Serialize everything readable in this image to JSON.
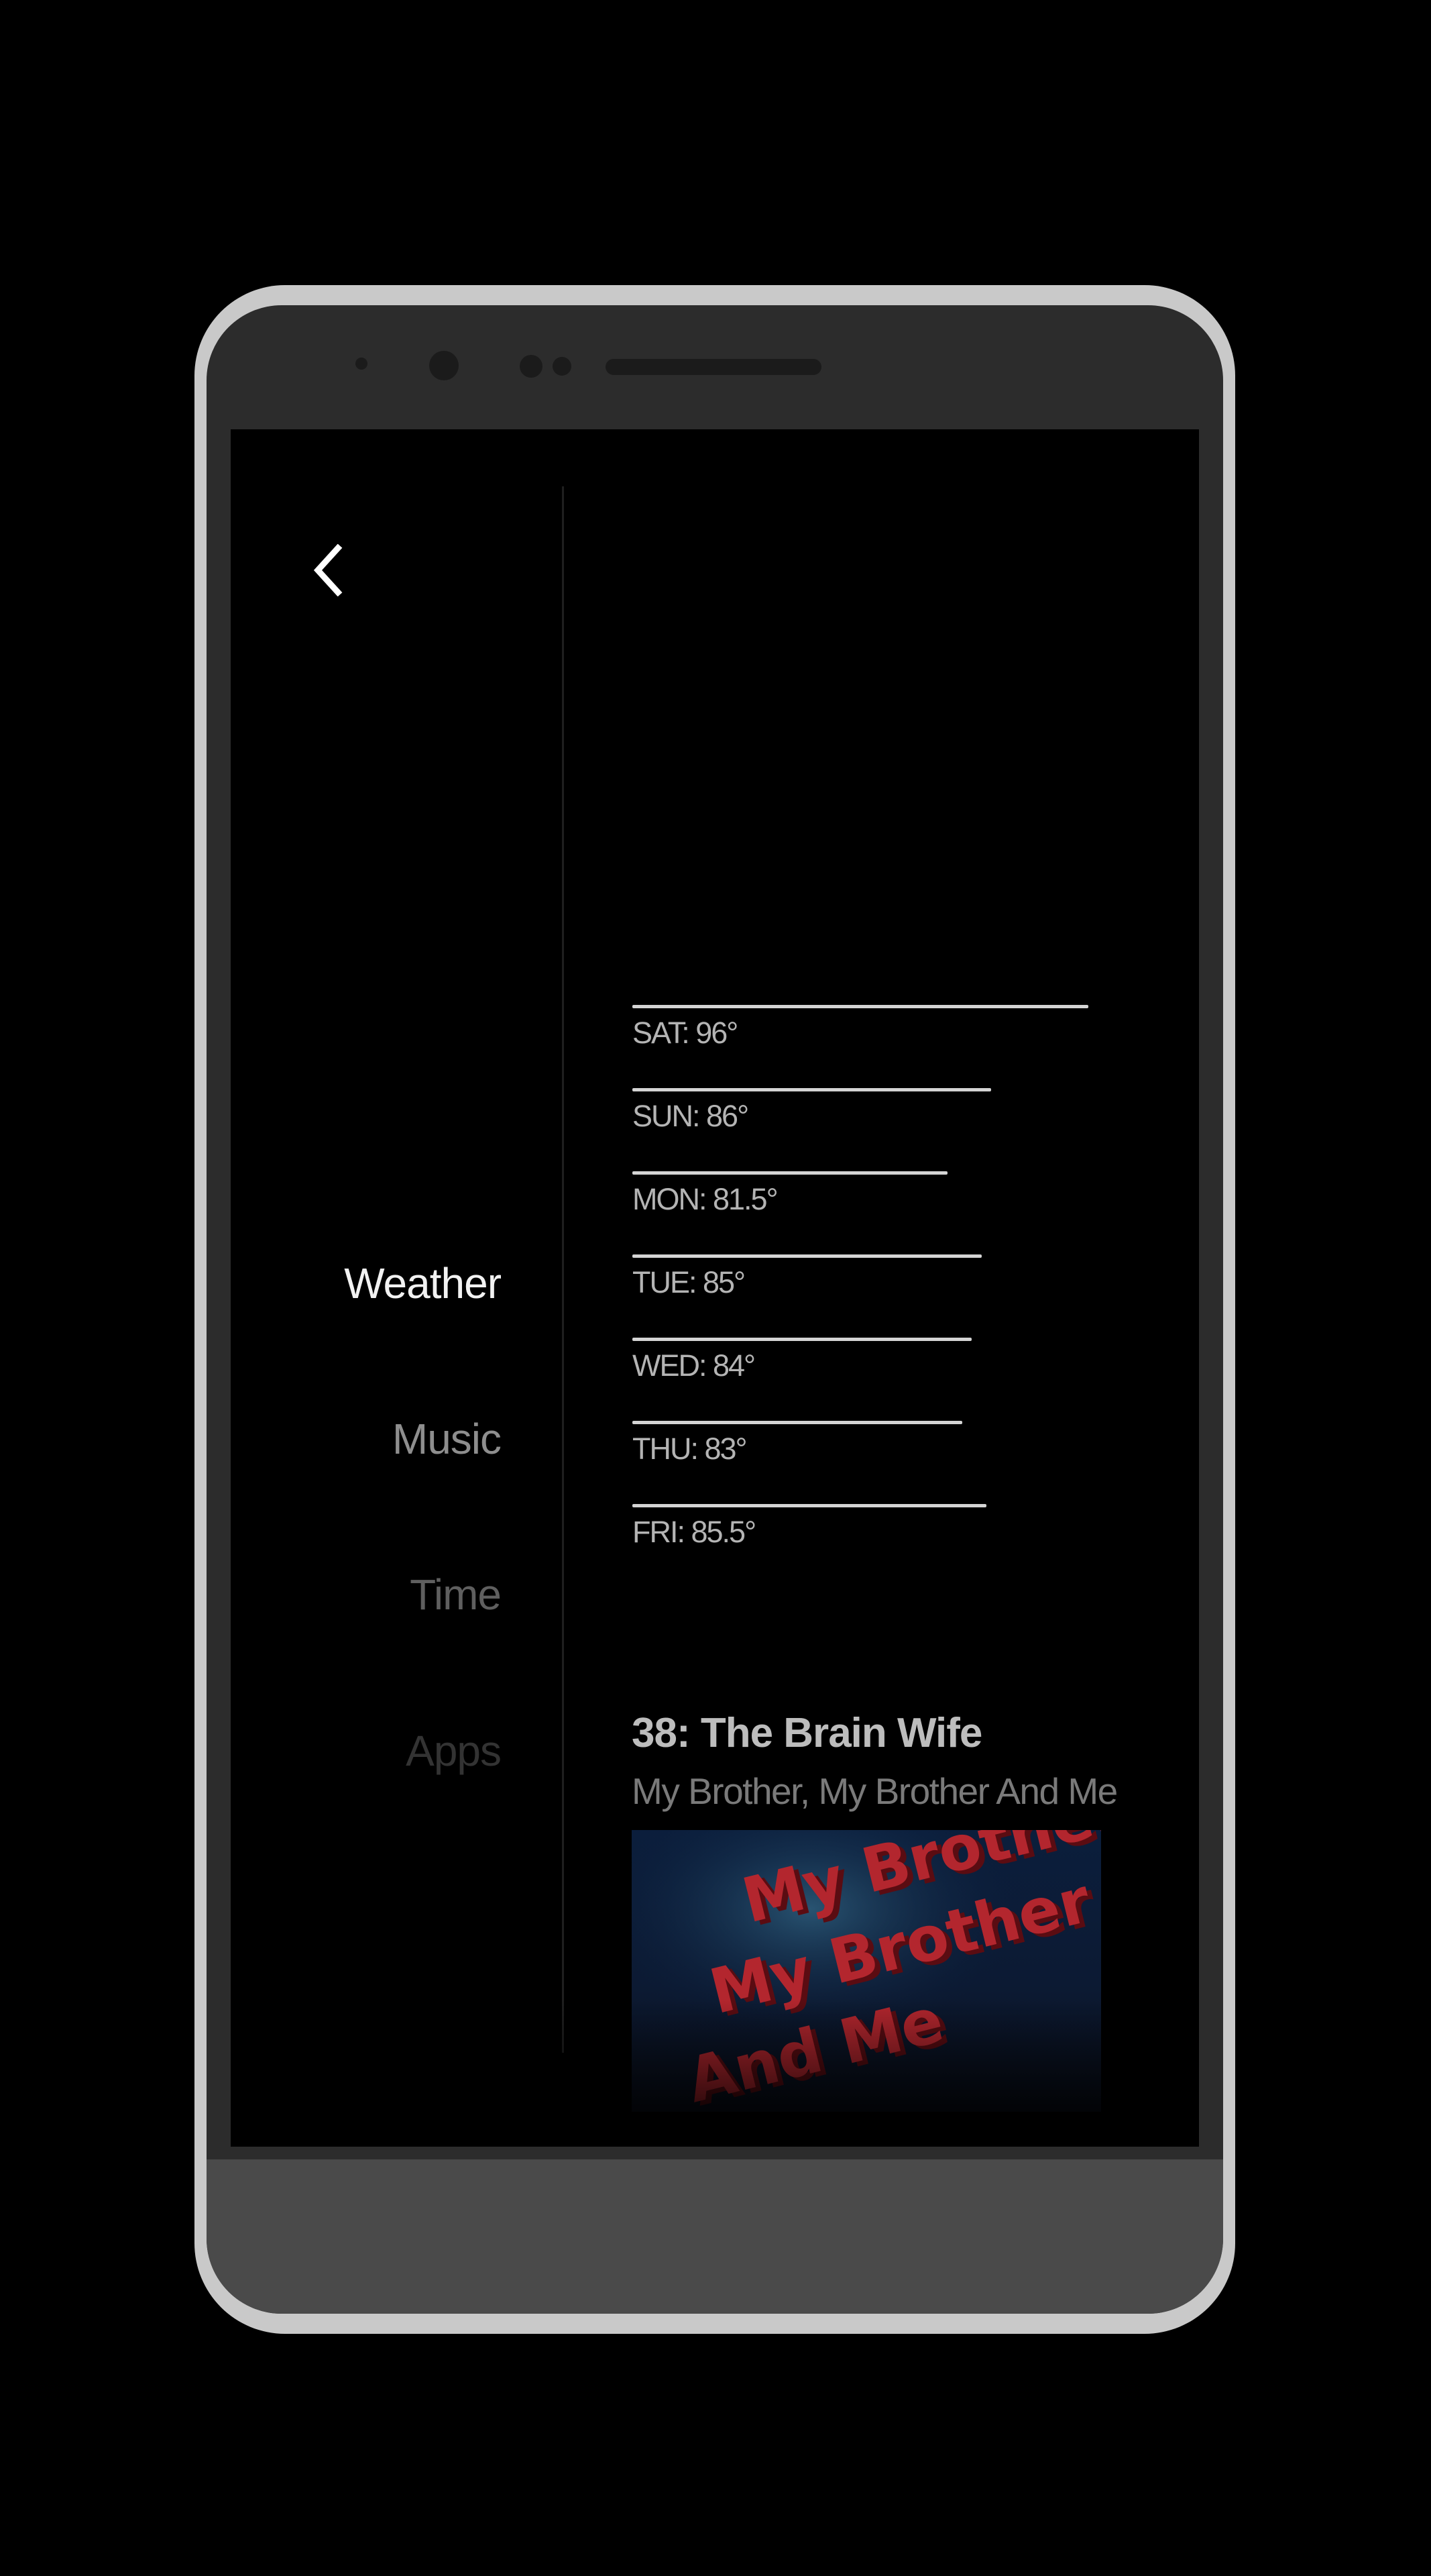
{
  "nav": {
    "items": [
      {
        "label": "Weather",
        "state": "active"
      },
      {
        "label": "Music",
        "state": "inactive"
      },
      {
        "label": "Time",
        "state": "inactive"
      },
      {
        "label": "Apps",
        "state": "inactive"
      }
    ]
  },
  "back_icon": "chevron-left-icon",
  "weather": {
    "days": [
      {
        "label": "SAT: 96°",
        "day": "SAT",
        "temp": 96
      },
      {
        "label": "SUN: 86°",
        "day": "SUN",
        "temp": 86
      },
      {
        "label": "MON: 81.5°",
        "day": "MON",
        "temp": 81.5
      },
      {
        "label": "TUE: 85°",
        "day": "TUE",
        "temp": 85
      },
      {
        "label": "WED: 84°",
        "day": "WED",
        "temp": 84
      },
      {
        "label": "THU: 83°",
        "day": "THU",
        "temp": 83
      },
      {
        "label": "FRI: 85.5°",
        "day": "FRI",
        "temp": 85.5
      }
    ]
  },
  "podcast": {
    "episode_title": "38: The Brain Wife",
    "show_name": "My Brother, My Brother And Me",
    "artwork_lettering": [
      "My Brother,",
      "My Brother",
      "And Me"
    ]
  },
  "colors": {
    "background": "#000000",
    "active_text": "#f2f2f2",
    "bar": "#d4d4d4",
    "artwork_red": "#b3262e",
    "frame": "#c9c9c9",
    "bezel": "#2c2c2c"
  }
}
